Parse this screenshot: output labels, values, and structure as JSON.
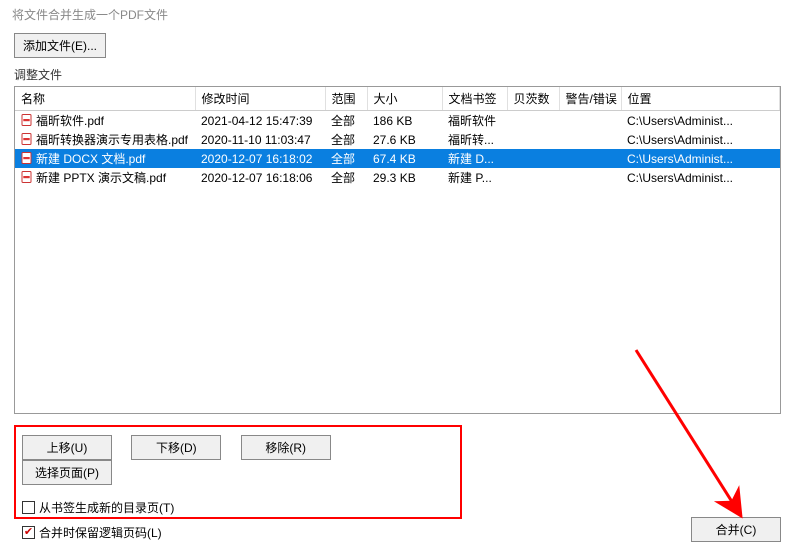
{
  "title": "将文件合并生成一个PDF文件",
  "add_file_btn": "添加文件(E)...",
  "adjust_label": "调整文件",
  "columns": {
    "name": "名称",
    "modified": "修改时间",
    "range": "范围",
    "size": "大小",
    "bookmark": "文档书签",
    "bates": "贝茨数",
    "warn": "警告/错误",
    "location": "位置"
  },
  "rows": [
    {
      "name": "福昕软件.pdf",
      "modified": "2021-04-12 15:47:39",
      "range": "全部",
      "size": "186 KB",
      "bookmark": "福昕软件",
      "bates": "",
      "warn": "",
      "location": "C:\\Users\\Administ...",
      "selected": false
    },
    {
      "name": "福昕转换器演示专用表格.pdf",
      "modified": "2020-11-10 11:03:47",
      "range": "全部",
      "size": "27.6 KB",
      "bookmark": "福昕转...",
      "bates": "",
      "warn": "",
      "location": "C:\\Users\\Administ...",
      "selected": false
    },
    {
      "name": "新建 DOCX 文档.pdf",
      "modified": "2020-12-07 16:18:02",
      "range": "全部",
      "size": "67.4 KB",
      "bookmark": "新建 D...",
      "bates": "",
      "warn": "",
      "location": "C:\\Users\\Administ...",
      "selected": true
    },
    {
      "name": "新建 PPTX 演示文稿.pdf",
      "modified": "2020-12-07 16:18:06",
      "range": "全部",
      "size": "29.3 KB",
      "bookmark": "新建 P...",
      "bates": "",
      "warn": "",
      "location": "C:\\Users\\Administ...",
      "selected": false
    }
  ],
  "buttons": {
    "up": "上移(U)",
    "down": "下移(D)",
    "remove": "移除(R)",
    "select_pages": "选择页面(P)",
    "merge": "合并(C)"
  },
  "checkboxes": {
    "gen_toc_label": "从书签生成新的目录页(T)",
    "gen_toc_checked": false,
    "keep_logical_label": "合并时保留逻辑页码(L)",
    "keep_logical_checked": true
  }
}
